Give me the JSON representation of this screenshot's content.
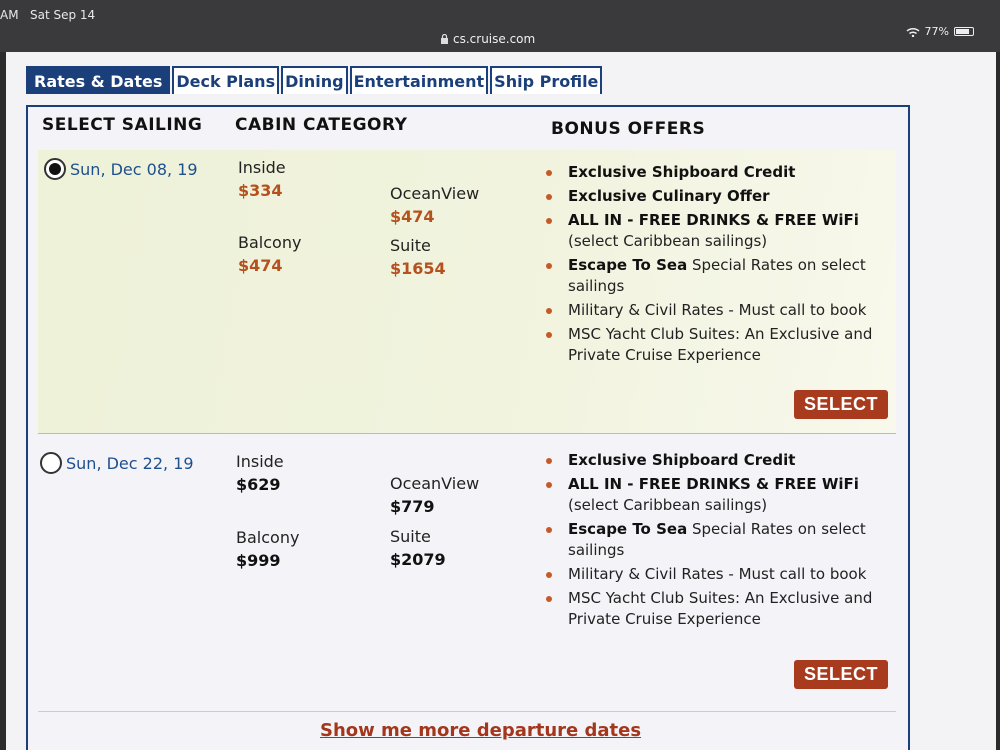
{
  "status": {
    "time": "AM",
    "date": "Sat Sep 14",
    "battery": "77%"
  },
  "browser": {
    "url": "cs.cruise.com"
  },
  "tabs": [
    "Rates & Dates",
    "Deck Plans",
    "Dining",
    "Entertainment",
    "Ship Profile"
  ],
  "headers": {
    "sailing": "SELECT SAILING",
    "cabin": "CABIN CATEGORY",
    "offers": "BONUS OFFERS"
  },
  "sailings": [
    {
      "date": "Sun, Dec 08, 19",
      "selected": true,
      "cabins": {
        "inside_label": "Inside",
        "inside_price": "$334",
        "oceanview_label": "OceanView",
        "oceanview_price": "$474",
        "balcony_label": "Balcony",
        "balcony_price": "$474",
        "suite_label": "Suite",
        "suite_price": "$1654"
      },
      "offers": [
        {
          "bold": "Exclusive Shipboard Credit",
          "rest": ""
        },
        {
          "bold": "Exclusive Culinary Offer",
          "rest": ""
        },
        {
          "bold": "ALL IN - FREE DRINKS & FREE WiFi",
          "rest": " (select Caribbean sailings)"
        },
        {
          "bold": "Escape To Sea",
          "rest": " Special Rates on select sailings"
        },
        {
          "bold": "",
          "rest": "Military & Civil Rates - Must call to book"
        },
        {
          "bold": "",
          "rest": "MSC Yacht Club Suites: An Exclusive and Private Cruise Experience"
        }
      ],
      "button": "SELECT"
    },
    {
      "date": "Sun, Dec 22, 19",
      "selected": false,
      "cabins": {
        "inside_label": "Inside",
        "inside_price": "$629",
        "oceanview_label": "OceanView",
        "oceanview_price": "$779",
        "balcony_label": "Balcony",
        "balcony_price": "$999",
        "suite_label": "Suite",
        "suite_price": "$2079"
      },
      "offers": [
        {
          "bold": "Exclusive Shipboard Credit",
          "rest": ""
        },
        {
          "bold": "ALL IN - FREE DRINKS & FREE WiFi",
          "rest": " (select Caribbean sailings)"
        },
        {
          "bold": "Escape To Sea",
          "rest": " Special Rates on select sailings"
        },
        {
          "bold": "",
          "rest": "Military & Civil Rates - Must call to book"
        },
        {
          "bold": "",
          "rest": "MSC Yacht Club Suites: An Exclusive and Private Cruise Experience"
        }
      ],
      "button": "SELECT"
    }
  ],
  "more_link": "Show me more departure dates",
  "colors": {
    "navy": "#1b3f7a",
    "sale_price": "#b5511f",
    "button": "#a83a1e",
    "date_link": "#1f4f8f"
  }
}
